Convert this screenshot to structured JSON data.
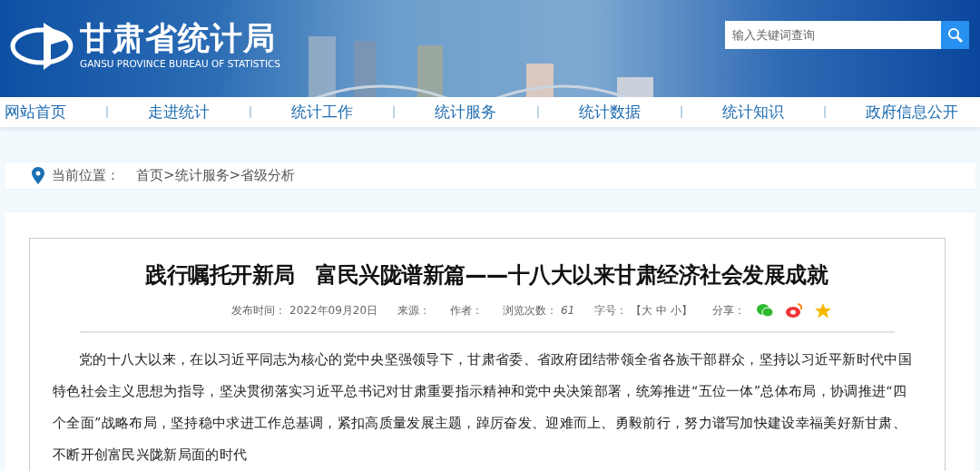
{
  "site": {
    "title": "甘肃省统计局",
    "subtitle": "GANSU PROVINCE BUREAU OF STATISTICS"
  },
  "search": {
    "placeholder": "输入关键词查询"
  },
  "nav": [
    {
      "label": "网站首页"
    },
    {
      "label": "走进统计"
    },
    {
      "label": "统计工作"
    },
    {
      "label": "统计服务"
    },
    {
      "label": "统计数据"
    },
    {
      "label": "统计知识"
    },
    {
      "label": "政府信息公开"
    }
  ],
  "breadcrumb": {
    "label": "当前位置：",
    "path": "首页>统计服务>省级分析"
  },
  "article": {
    "title": "践行嘱托开新局　富民兴陇谱新篇——十八大以来甘肃经济社会发展成就",
    "meta": [
      {
        "kind": "field",
        "label": "发布时间：",
        "value": "2022年09月20日"
      },
      {
        "kind": "field",
        "label": "来源："
      },
      {
        "kind": "field",
        "label": "作者："
      },
      {
        "kind": "count",
        "label": "浏览次数：",
        "value": "61"
      },
      {
        "kind": "field",
        "label": "字号：",
        "value": "【大 中 小】"
      },
      {
        "kind": "share",
        "label": "分享："
      }
    ],
    "body": "党的十八大以来，在以习近平同志为核心的党中央坚强领导下，甘肃省委、省政府团结带领全省各族干部群众，坚持以习近平新时代中国特色社会主义思想为指导，坚决贯彻落实习近平总书记对甘肃重要指示精神和党中央决策部署，统筹推进“五位一体”总体布局，协调推进“四个全面”战略布局，坚持稳中求进工作总基调，紧扣高质量发展主题，踔厉奋发、迎难而上、勇毅前行，努力谱写加快建设幸福美好新甘肃、不断开创富民兴陇新局面的时代"
  }
}
